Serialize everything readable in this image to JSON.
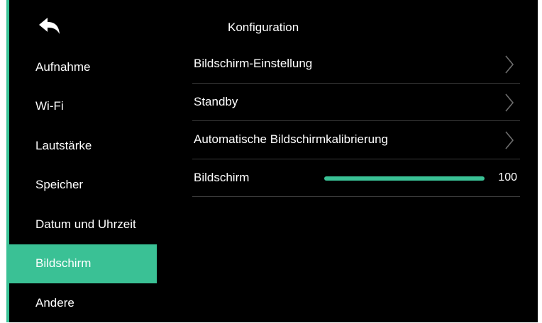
{
  "header": {
    "title": "Konfiguration",
    "back_icon": "back-arrow-icon"
  },
  "sidebar": {
    "items": [
      {
        "label": "Aufnahme"
      },
      {
        "label": "Wi-Fi"
      },
      {
        "label": "Lautstärke"
      },
      {
        "label": "Speicher"
      },
      {
        "label": "Datum und Uhrzeit"
      },
      {
        "label": "Bildschirm",
        "active": true
      },
      {
        "label": "Andere"
      }
    ]
  },
  "settings": {
    "rows": [
      {
        "label": "Bildschirm-Einstellung",
        "icon": "chevron-right-icon"
      },
      {
        "label": "Standby",
        "icon": "chevron-right-icon"
      },
      {
        "label": "Automatische Bildschirmkalibrierung",
        "icon": "chevron-right-icon"
      }
    ],
    "brightness": {
      "label": "Bildschirm",
      "value": "100",
      "fill_percent": 100
    }
  },
  "colors": {
    "accent": "#3ac195",
    "background": "#000000",
    "text": "#ffffff",
    "divider": "#3a3a3a"
  }
}
